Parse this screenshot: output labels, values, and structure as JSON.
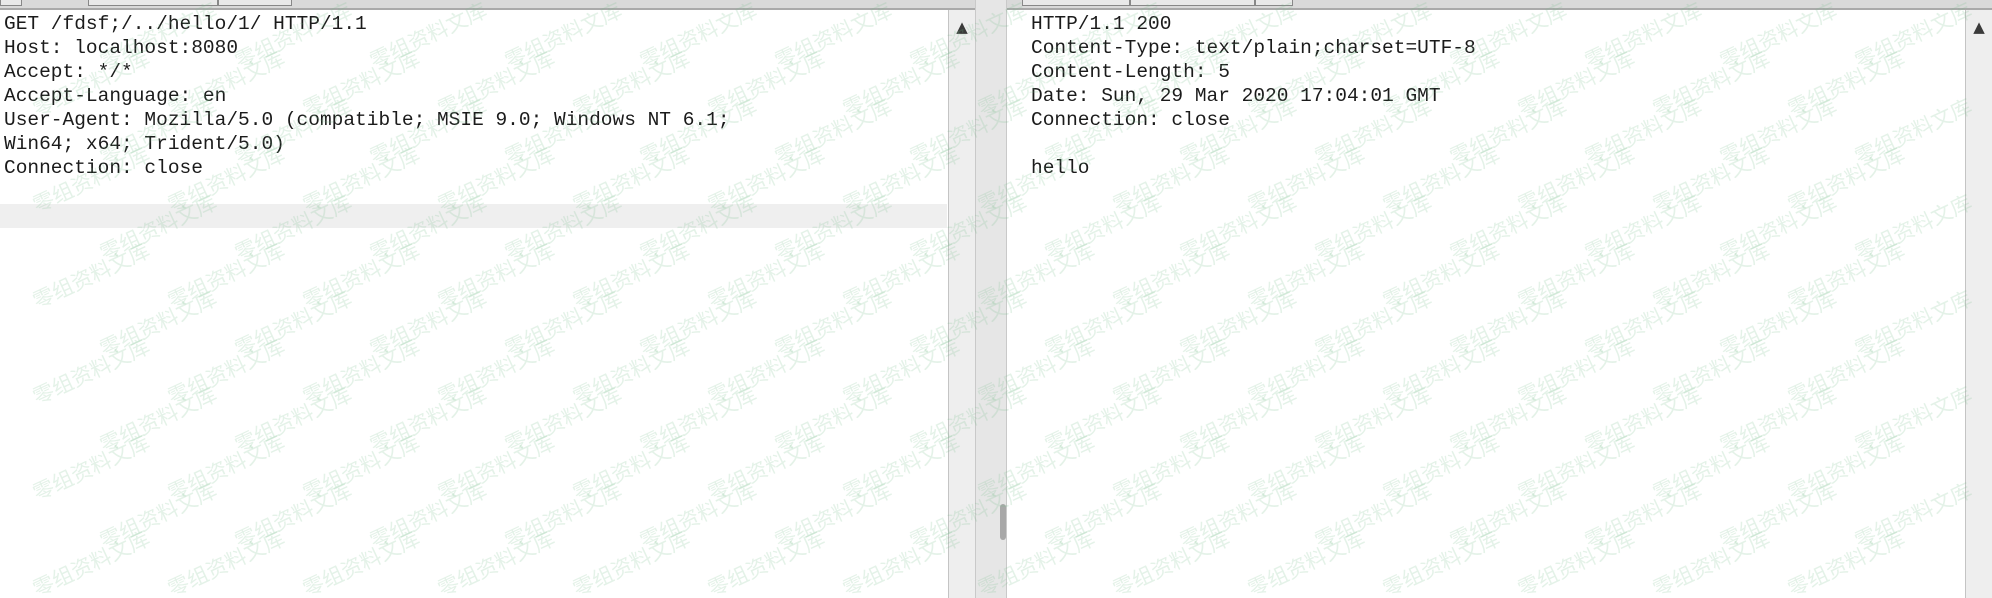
{
  "request_pane": {
    "lines": [
      "GET /fdsf;/../hello/1/ HTTP/1.1",
      "Host: localhost:8080",
      "Accept: */*",
      "Accept-Language: en",
      "User-Agent: Mozilla/5.0 (compatible; MSIE 9.0; Windows NT 6.1;",
      "Win64; x64; Trident/5.0)",
      "Connection: close"
    ]
  },
  "response_pane": {
    "lines": [
      "HTTP/1.1 200",
      "Content-Type: text/plain;charset=UTF-8",
      "Content-Length: 5",
      "Date: Sun, 29 Mar 2020 17:04:01 GMT",
      "Connection: close",
      "",
      "hello"
    ]
  },
  "scrollbar": {
    "up_arrow_icon": "triangle-up-icon"
  },
  "watermark": {
    "text": "零组资料文库"
  },
  "colors": {
    "text": "#1b1b1b",
    "watermark": "#76be8a",
    "highlight_row": "#efefef",
    "chrome": "#e6e6e6"
  }
}
